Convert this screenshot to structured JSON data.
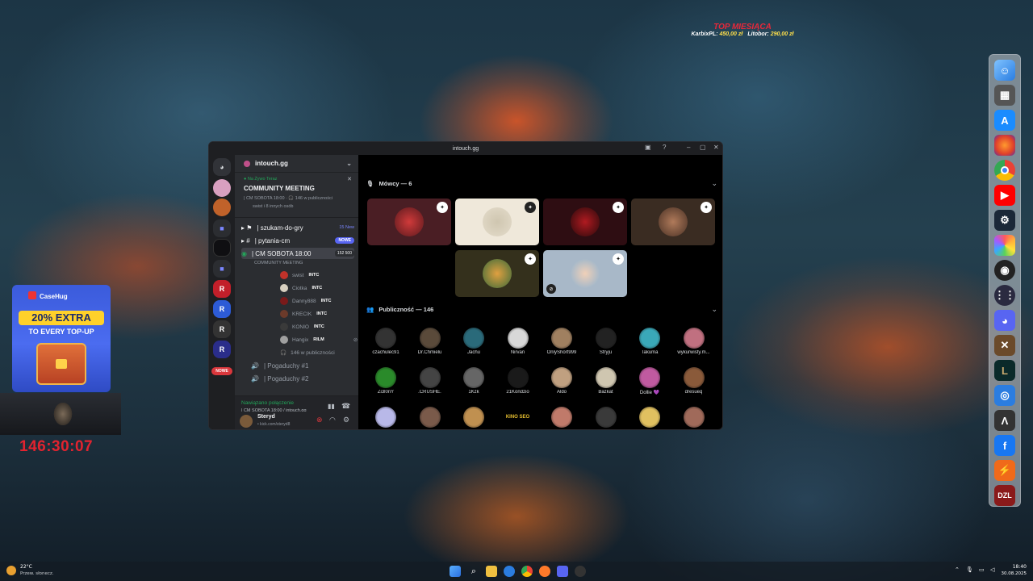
{
  "overlay": {
    "top_title": "TOP MIESIĄCA",
    "top_entries": [
      {
        "name": "KarbixPL:",
        "amount": "450,00 zł"
      },
      {
        "name": "Litobor:",
        "amount": "290,00 zł"
      }
    ],
    "promo": {
      "brand": "CaseHug",
      "headline": "20% EXTRA",
      "sub": "TO EVERY TOP-UP"
    },
    "timer": "146:30:07"
  },
  "dock": {
    "icons": [
      "finder-icon",
      "calculator-icon",
      "app-store-icon",
      "firefox-icon",
      "chrome-icon",
      "youtube-icon",
      "steam-icon",
      "photos-icon",
      "obs-icon",
      "launchpad-icon",
      "discord-icon",
      "game-icon",
      "league-icon",
      "edge-icon",
      "epic-icon",
      "facebook-icon",
      "zap-icon",
      "dzl-icon"
    ],
    "dzl_label": "DZL"
  },
  "window": {
    "title": "intouch.gg",
    "server_name": "intouch.gg",
    "event": {
      "live_label": "Na Żywo Teraz",
      "title": "COMMUNITY MEETING",
      "meta": "| CM SOBOTA 18:00 · 🎧 146 w publiczności",
      "others": "swist i 8 innych osób"
    },
    "channels": [
      {
        "name": "| szukam-do-gry",
        "badge": "15 New"
      },
      {
        "name": "| pytania-cm",
        "badge": "NOWE"
      },
      {
        "name": "| CM SOBOTA 18:00",
        "badge": "152 500"
      }
    ],
    "channel_sub": "COMMUNITY MEETING",
    "stage_users": [
      {
        "name": "swist",
        "tag": "INTC"
      },
      {
        "name": "Ciotka",
        "tag": "INTC"
      },
      {
        "name": "Danny888",
        "tag": "INTC"
      },
      {
        "name": "KRECIK",
        "tag": "INTC"
      },
      {
        "name": "KONIO",
        "tag": "INTC"
      },
      {
        "name": "Hangix",
        "tag": "RILM"
      }
    ],
    "audience_summary": "146 w publiczności",
    "voice_channels": [
      "| Pogaduchy #1",
      "| Pogaduchy #2"
    ],
    "new_label": "NOWE",
    "connection": {
      "status": "Nawiązano połączenie",
      "channel": "| CM SOBOTA 18:00 / intouch.gg"
    },
    "user": {
      "name": "Steryd",
      "status": "• kick.com/steryd8"
    },
    "speakers_header": "Mówcy — 6",
    "audience_header": "Publiczność — 146",
    "audience": [
      "czachulec91",
      "Dr.Chmielu",
      "Jachu",
      "Nirvan",
      "OnlyShort999",
      "Stryju",
      "Takuma",
      "wykurwisty.m...",
      "Zi3l0nY",
      ".CRUSHE.",
      "1Kzk",
      "21Kondzio",
      "Aldo",
      "Bazkat",
      "Dollie 💜",
      "dresueq",
      "",
      "",
      "",
      "",
      "",
      "",
      "",
      ""
    ],
    "kino_label": "KINO SEO"
  },
  "taskbar": {
    "weather_temp": "22°C",
    "weather_desc": "Przew. słonecz.",
    "time": "18:40",
    "date": "30.08.2025"
  },
  "colors": {
    "discord_bg": "#111214",
    "sidebar": "#2b2d31",
    "accent": "#5865f2",
    "timer": "#e2232f",
    "top_title": "#e8283a"
  }
}
